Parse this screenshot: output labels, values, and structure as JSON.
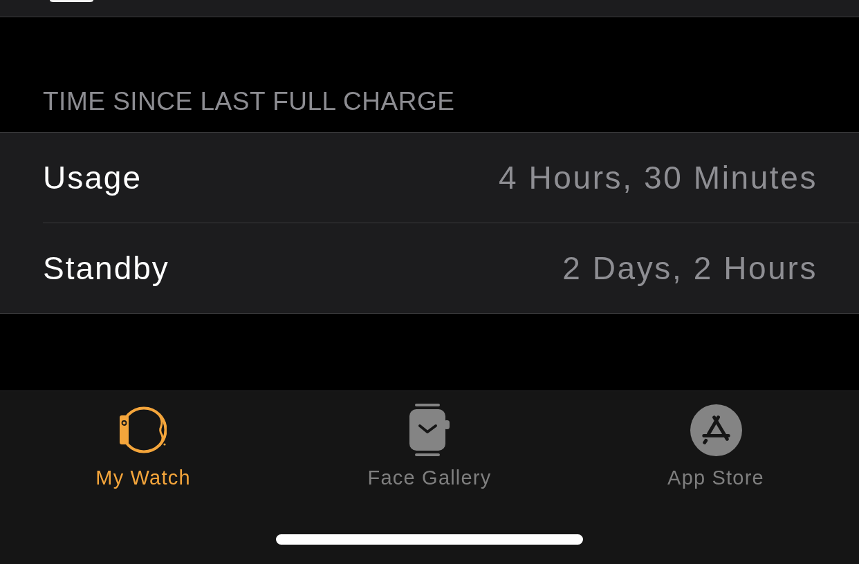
{
  "section": {
    "header": "TIME SINCE LAST FULL CHARGE",
    "rows": [
      {
        "label": "Usage",
        "value": "4 Hours, 30 Minutes"
      },
      {
        "label": "Standby",
        "value": "2 Days, 2 Hours"
      }
    ]
  },
  "tab_bar": {
    "tabs": [
      {
        "kind": "watch",
        "label": "My Watch",
        "selected": true
      },
      {
        "kind": "gallery",
        "label": "Face Gallery",
        "selected": false
      },
      {
        "kind": "store",
        "label": "App Store",
        "selected": false
      }
    ]
  }
}
